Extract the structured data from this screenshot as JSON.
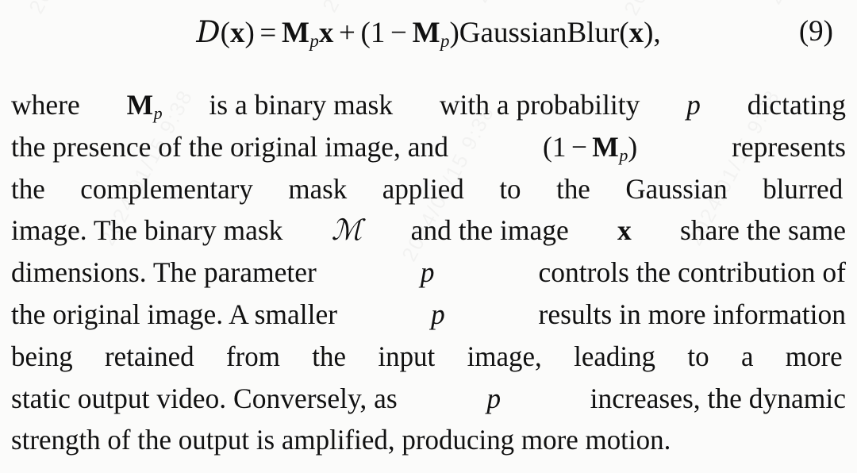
{
  "document": {
    "type": "academic-paper-excerpt",
    "background_color": "#fbfbfa",
    "text_color": "#111111"
  },
  "watermark": {
    "visible": true,
    "text": "2024/01/15 9:38",
    "opacity": 0.03,
    "angle_deg": -62
  },
  "equation": {
    "number": "(9)",
    "latex": "\\mathcal{D}(\\mathbf{x}) = \\mathbf{M}_p\\mathbf{x} + (1 - \\mathbf{M}_p)\\mathrm{GaussianBlur}(\\mathbf{x}),",
    "plain_text": "D(x) = M_p x + (1 - M_p)GaussianBlur(x),",
    "tokens": {
      "lhs_operator": "D",
      "lhs_arg": "x",
      "equals": "=",
      "mask_symbol": "M",
      "mask_subscript": "p",
      "variable": "x",
      "plus": "+",
      "one": "1",
      "minus": "−",
      "function_name": "GaussianBlur",
      "comma": ","
    }
  },
  "paragraph": {
    "full_text": "where M_p is a binary mask with a probability p dictating the presence of the original image, and (1 - M_p) represents the complementary mask applied to the Gaussian blurred image. The binary mask M and the image x share the same dimensions. The parameter p controls the contribution of the original image. A smaller p results in more information being retained from the input image, leading to a more static output video. Conversely, as p increases, the dynamic strength of the output is amplified, producing more motion.",
    "lines": [
      {
        "id": "line-1",
        "justified": true,
        "words": [
          "where",
          "M",
          "is",
          "a",
          "binary",
          "mask",
          "with",
          "a",
          "probability",
          "p",
          "dictating"
        ]
      },
      {
        "id": "line-2",
        "justified": true,
        "words": [
          "the",
          "presence",
          "of",
          "the",
          "original",
          "image,",
          "and",
          "(1",
          "−",
          "M",
          ")",
          "represents"
        ]
      },
      {
        "id": "line-3",
        "justified": true,
        "words": [
          "the",
          "complementary",
          "mask",
          "applied",
          "to",
          "the",
          "Gaussian",
          "blurred"
        ]
      },
      {
        "id": "line-4",
        "justified": true,
        "words": [
          "image.",
          "The",
          "binary",
          "mask",
          "M",
          "and",
          "the",
          "image",
          "x",
          "share",
          "the",
          "same"
        ]
      },
      {
        "id": "line-5",
        "justified": true,
        "words": [
          "dimensions.",
          "The",
          "parameter",
          "p",
          "controls",
          "the",
          "contribution",
          "of"
        ]
      },
      {
        "id": "line-6",
        "justified": true,
        "words": [
          "the",
          "original",
          "image.",
          "A",
          "smaller",
          "p",
          "results",
          "in",
          "more",
          "information"
        ]
      },
      {
        "id": "line-7",
        "justified": true,
        "words": [
          "being",
          "retained",
          "from",
          "the",
          "input",
          "image,",
          "leading",
          "to",
          "a",
          "more"
        ]
      },
      {
        "id": "line-8",
        "justified": true,
        "words": [
          "static",
          "output",
          "video.",
          "Conversely,",
          "as",
          "p",
          "increases,",
          "the",
          "dynamic"
        ]
      },
      {
        "id": "line-9",
        "justified": false,
        "words": [
          "strength",
          "of",
          "the",
          "output",
          "is",
          "amplified,",
          "producing",
          "more",
          "motion."
        ]
      }
    ],
    "line_text": {
      "l1_a": "where",
      "l1_b": "is a binary mask",
      "l1_c": "with a probability",
      "l1_d": "dictating",
      "l2_a": "the presence of the original image, and",
      "l2_b": "represents",
      "l3": "the complementary mask applied to the Gaussian blurred",
      "l4_a": "image. The binary mask",
      "l4_b": "and the image",
      "l4_c": "share the same",
      "l5_a": "dimensions.  The parameter",
      "l5_b": "controls the contribution of",
      "l6_a": "the original image. A smaller",
      "l6_b": "results in more information",
      "l7": "being retained from the input image, leading to a more",
      "l8_a": "static output video. Conversely, as",
      "l8_b": "increases, the dynamic",
      "l9": "strength of the output is amplified, producing more motion."
    },
    "symbols": {
      "mask_bold_M": "M",
      "mask_subscript_p": "p",
      "script_M": "ℳ",
      "bold_x": "x",
      "param_p": "p",
      "open_paren_one": "(1",
      "minus": "−",
      "close_paren": ")"
    }
  }
}
